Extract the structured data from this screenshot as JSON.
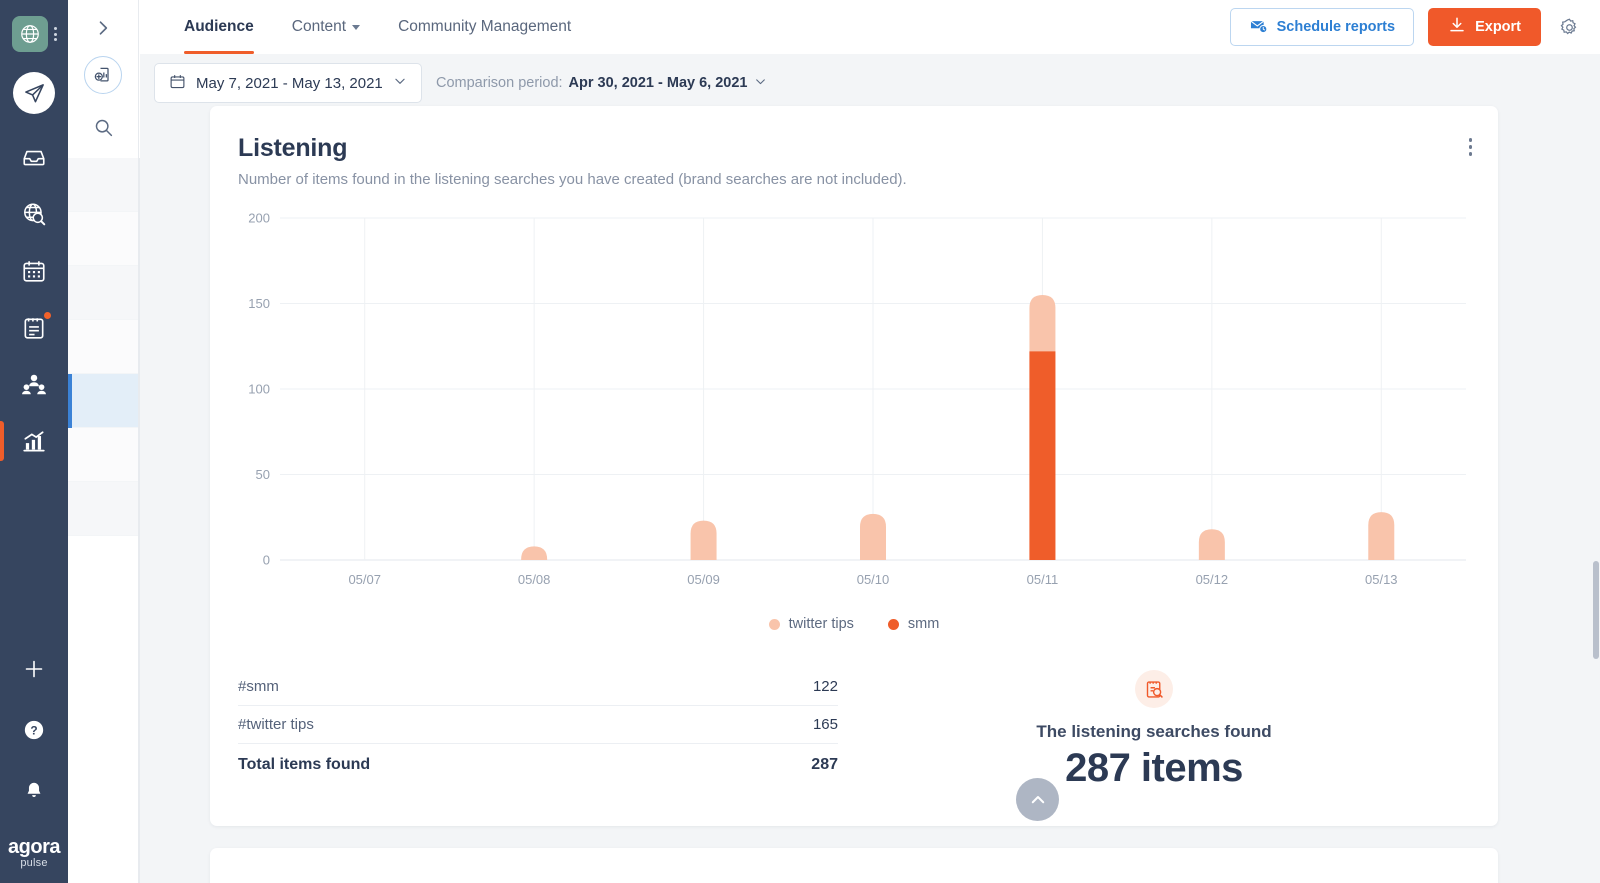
{
  "rail": {
    "brand_icon": "globe-network-icon",
    "kebab_icon": "rail-more-icon",
    "compose_icon": "paper-plane-icon",
    "items": [
      {
        "name": "inbox",
        "icon": "inbox-tray-icon",
        "badge": false
      },
      {
        "name": "listening",
        "icon": "globe-search-icon",
        "badge": false
      },
      {
        "name": "publishing",
        "icon": "calendar-icon",
        "badge": false
      },
      {
        "name": "tasks",
        "icon": "clipboard-icon",
        "badge": true
      },
      {
        "name": "fans",
        "icon": "users-icon",
        "badge": false
      },
      {
        "name": "reports",
        "icon": "bar-chart-icon",
        "badge": false
      }
    ],
    "bottom_items": [
      {
        "name": "add",
        "icon": "plus-icon"
      },
      {
        "name": "help",
        "icon": "question-circle-icon"
      },
      {
        "name": "notifications",
        "icon": "bell-icon"
      }
    ],
    "logo_primary": "agora",
    "logo_secondary": "pulse"
  },
  "panel2": {
    "expand_icon": "chevron-right-icon",
    "report_icon": "report-add-icon",
    "search_icon": "search-icon"
  },
  "header": {
    "tabs": [
      {
        "label": "Audience",
        "active": true,
        "has_caret": false
      },
      {
        "label": "Content",
        "active": false,
        "has_caret": true
      },
      {
        "label": "Community Management",
        "active": false,
        "has_caret": false
      }
    ],
    "schedule_label": "Schedule reports",
    "schedule_icon": "mail-clock-icon",
    "export_label": "Export",
    "export_icon": "download-icon",
    "settings_icon": "gear-icon",
    "accent_blue": "#2d7fd3",
    "accent_orange": "#f0592a"
  },
  "filters": {
    "calendar_icon": "calendar-icon",
    "date_range": "May 7, 2021 - May 13, 2021",
    "date_caret_icon": "chevron-down-icon",
    "comparison_prefix": "Comparison period:",
    "comparison_value": "Apr 30, 2021 - May 6, 2021",
    "comparison_caret_icon": "chevron-down-icon"
  },
  "card": {
    "title": "Listening",
    "subtitle": "Number of items found in the listening searches you have created (brand searches are not included).",
    "kebab_icon": "more-vertical-icon"
  },
  "chart_data": {
    "type": "bar",
    "stacked": true,
    "title": "Listening",
    "xlabel": "",
    "ylabel": "",
    "ylim": [
      0,
      200
    ],
    "yticks": [
      0,
      50,
      100,
      150,
      200
    ],
    "grid": true,
    "legend_position": "bottom",
    "categories": [
      "05/07",
      "05/08",
      "05/09",
      "05/10",
      "05/11",
      "05/12",
      "05/13"
    ],
    "series": [
      {
        "name": "smm",
        "color": "#ef5d2a",
        "values": [
          0,
          0,
          0,
          0,
          122,
          0,
          0
        ]
      },
      {
        "name": "twitter tips",
        "color": "#f9c4ab",
        "values": [
          0,
          8,
          23,
          27,
          33,
          18,
          28
        ]
      }
    ]
  },
  "legend": [
    {
      "label": "twitter tips",
      "color": "#f9c4ab"
    },
    {
      "label": "smm",
      "color": "#ef5d2a"
    }
  ],
  "table": {
    "rows": [
      {
        "label": "#smm",
        "value": "122"
      },
      {
        "label": "#twitter tips",
        "value": "165"
      }
    ],
    "total_label": "Total items found",
    "total_value": "287"
  },
  "summary": {
    "icon": "listening-search-icon",
    "label": "The listening searches found",
    "value": "287 items"
  },
  "scroll_top": {
    "icon": "chevron-up-icon"
  }
}
